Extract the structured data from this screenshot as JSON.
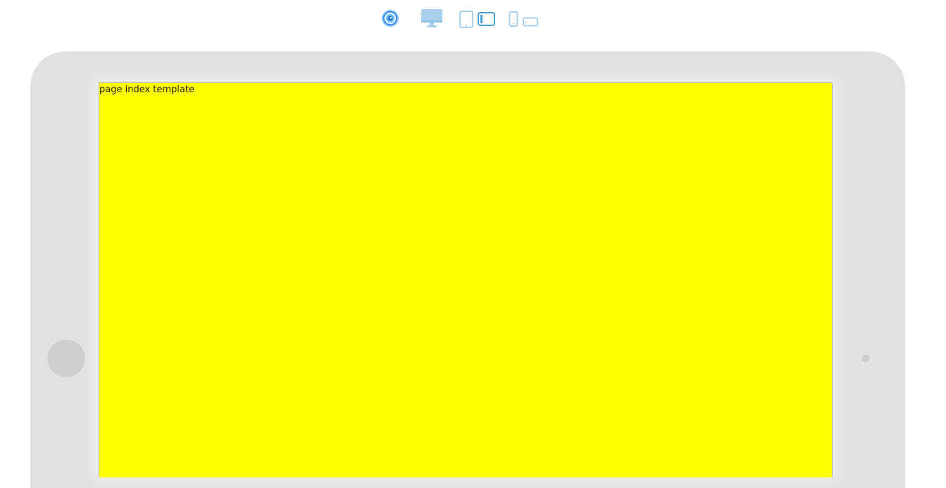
{
  "toolbar": {
    "buttons": [
      {
        "icon": "swirl-logo-icon",
        "color": "#3399ff"
      },
      {
        "icon": "desktop-monitor-icon",
        "color": "#a9d0ec"
      },
      {
        "icon": "tablet-portrait-icon",
        "color": "#a9d0ec"
      },
      {
        "icon": "tablet-landscape-icon",
        "color": "#4a9fd6",
        "active": true
      },
      {
        "icon": "phone-portrait-icon",
        "color": "#a9d0ec"
      },
      {
        "icon": "phone-landscape-icon",
        "color": "#a9d0ec"
      }
    ]
  },
  "device": {
    "type": "tablet-landscape",
    "frame_color": "#e1e1e1",
    "screen_color": "#ffff00"
  },
  "screen": {
    "text": "page index template"
  }
}
